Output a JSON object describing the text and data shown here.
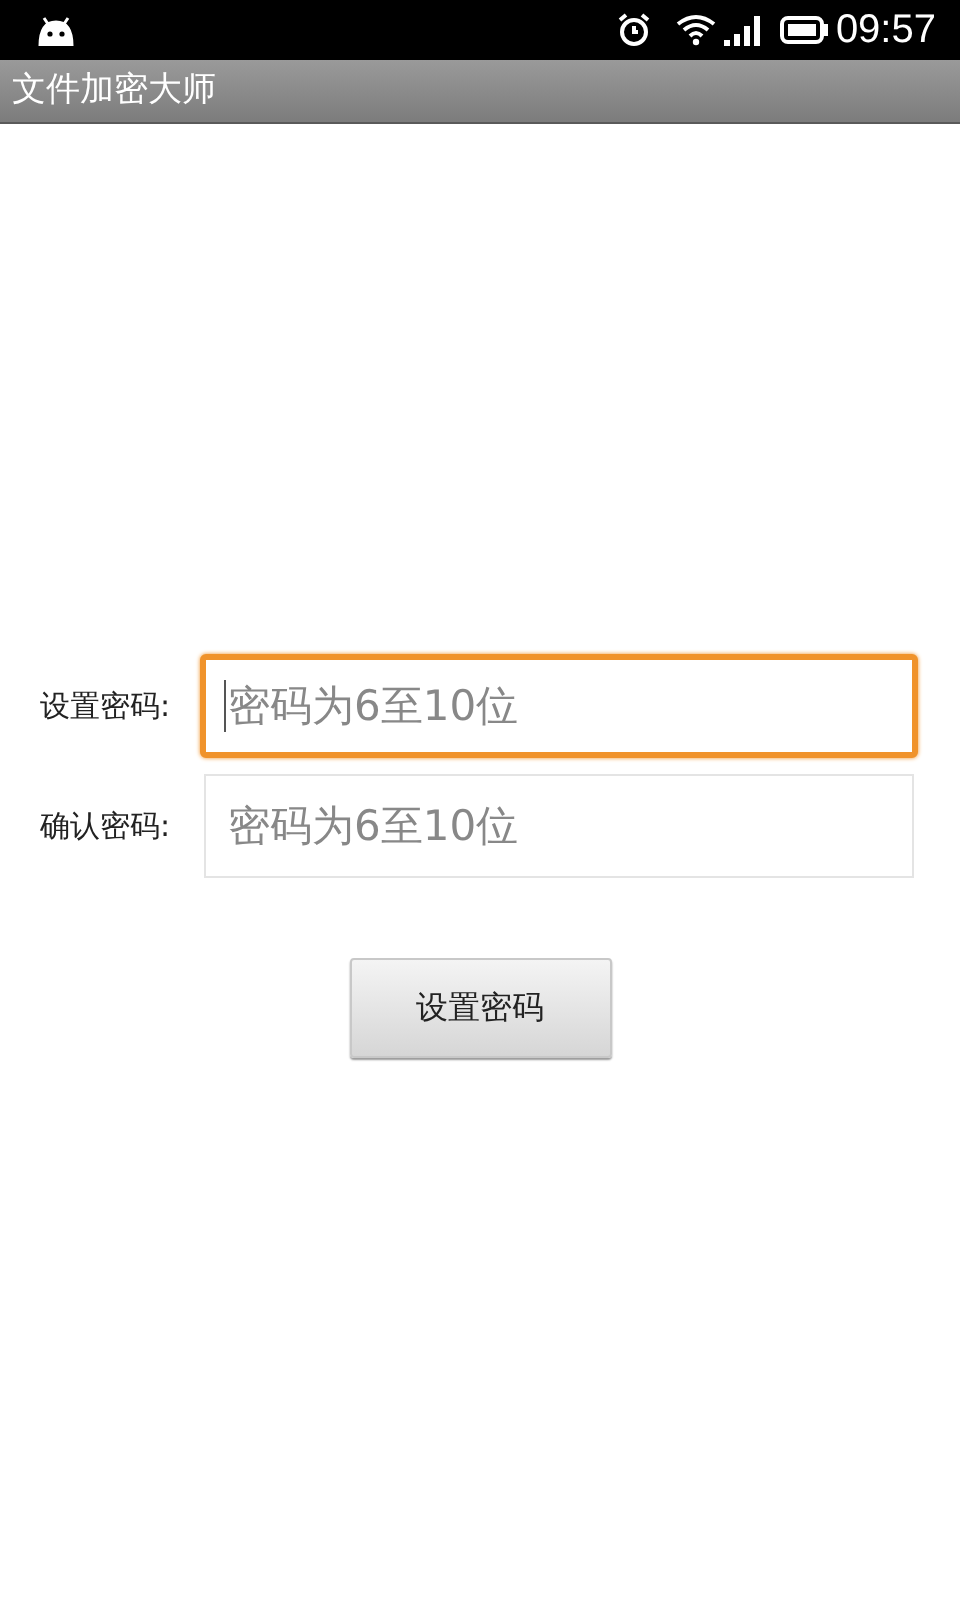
{
  "status_bar": {
    "time": "09:57"
  },
  "app_bar": {
    "title": "文件加密大师"
  },
  "form": {
    "fields": [
      {
        "label": "设置密码:",
        "placeholder": "密码为6至10位",
        "focused": true
      },
      {
        "label": "确认密码:",
        "placeholder": "密码为6至10位",
        "focused": false
      }
    ],
    "button": "设置密码"
  }
}
